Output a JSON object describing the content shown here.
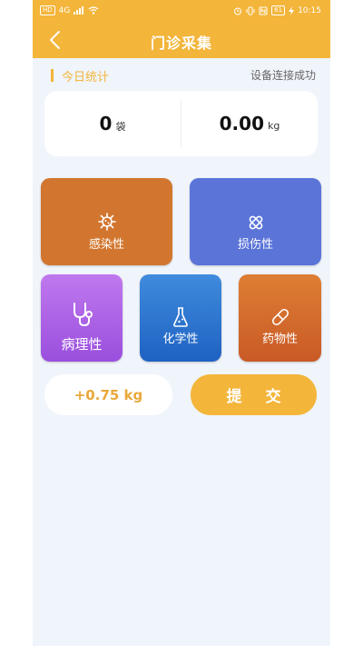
{
  "statusbar": {
    "carrier": "HD",
    "network": "4G",
    "battery": "61",
    "time": "10:15"
  },
  "navbar": {
    "title": "门诊采集"
  },
  "stats": {
    "title": "今日统计",
    "device_status": "设备连接成功",
    "bags_value": "0",
    "bags_unit": "袋",
    "weight_value": "0.00",
    "weight_unit": "kg"
  },
  "categories": [
    {
      "label": "感染性",
      "icon": "virus-icon",
      "color": "#d2762f"
    },
    {
      "label": "损伤性",
      "icon": "bandage-icon",
      "color": "#5a74d8"
    },
    {
      "label": "病理性",
      "icon": "stethoscope-icon",
      "color": "#a45de3"
    },
    {
      "label": "化学性",
      "icon": "flask-icon",
      "color": "#2a74cf"
    },
    {
      "label": "药物性",
      "icon": "pill-icon",
      "color": "#d56a2e"
    }
  ],
  "weight_readout": "+0.75 kg",
  "submit_label": "提 交"
}
